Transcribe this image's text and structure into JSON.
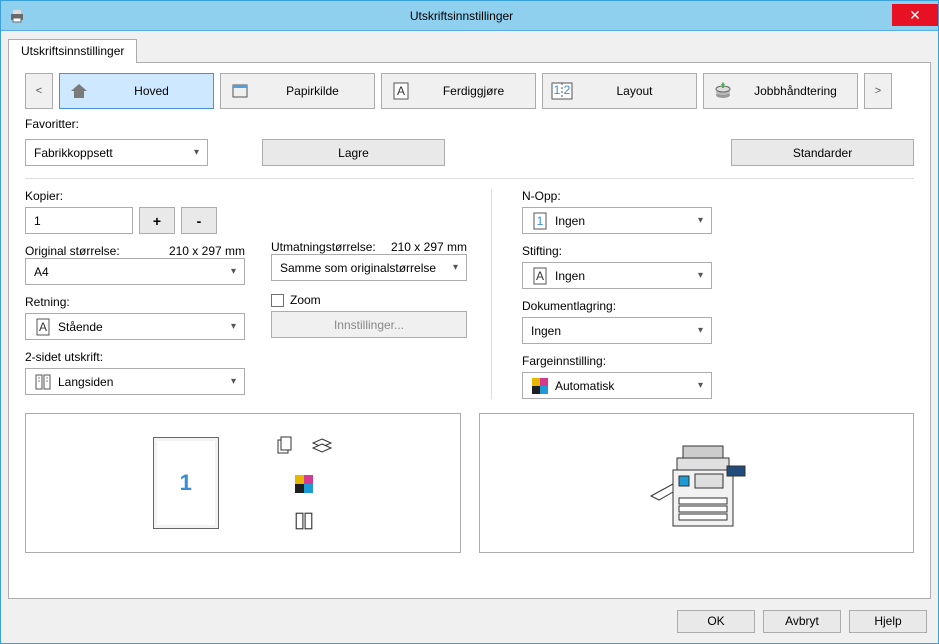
{
  "window": {
    "title": "Utskriftsinnstillinger"
  },
  "tab_label": "Utskriftsinnstillinger",
  "nav": {
    "items": [
      {
        "label": "Hoved"
      },
      {
        "label": "Papirkilde"
      },
      {
        "label": "Ferdiggjøre"
      },
      {
        "label": "Layout"
      },
      {
        "label": "Jobbhåndtering"
      }
    ]
  },
  "favorites": {
    "label": "Favoritter:",
    "value": "Fabrikkoppsett",
    "save_label": "Lagre",
    "defaults_label": "Standarder"
  },
  "left": {
    "copies_label": "Kopier:",
    "copies_value": "1",
    "orig_size_label": "Original størrelse:",
    "orig_size_dim": "210 x 297 mm",
    "orig_size_value": "A4",
    "orientation_label": "Retning:",
    "orientation_value": "Stående",
    "duplex_label": "2-sidet utskrift:",
    "duplex_value": "Langsiden"
  },
  "mid": {
    "out_size_label": "Utmatningstørrelse:",
    "out_size_dim": "210 x 297 mm",
    "out_size_value": "Samme som originalstørrelse",
    "zoom_label": "Zoom",
    "settings_label": "Innstillinger..."
  },
  "right": {
    "nup_label": "N-Opp:",
    "nup_value": "Ingen",
    "staple_label": "Stifting:",
    "staple_value": "Ingen",
    "docstore_label": "Dokumentlagring:",
    "docstore_value": "Ingen",
    "color_label": "Fargeinnstilling:",
    "color_value": "Automatisk"
  },
  "preview": {
    "page_number": "1"
  },
  "footer": {
    "ok": "OK",
    "cancel": "Avbryt",
    "help": "Hjelp"
  }
}
